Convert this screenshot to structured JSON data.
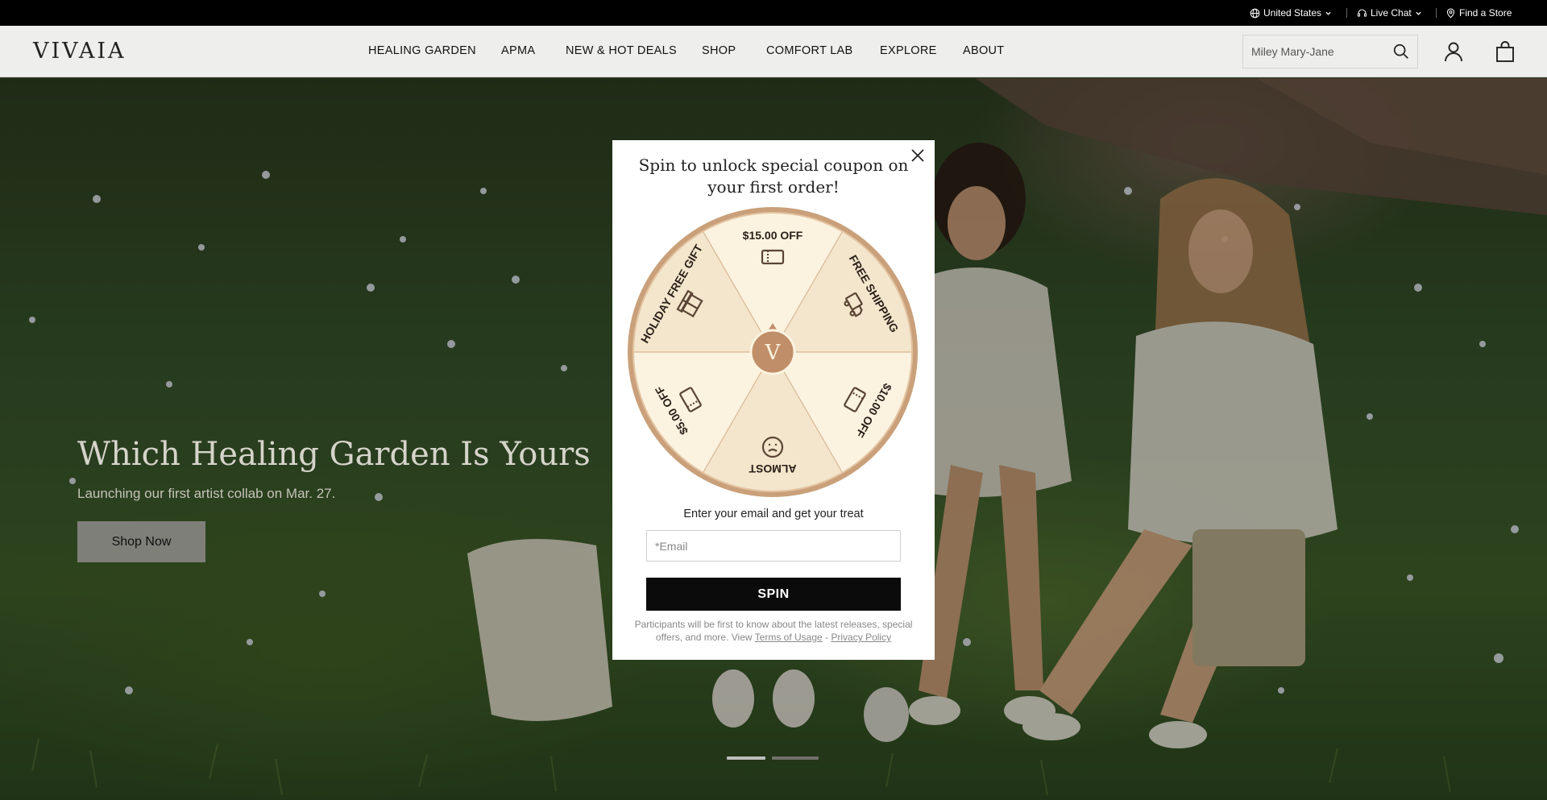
{
  "topbar": {
    "region": "United States",
    "live_chat": "Live Chat",
    "store": "Find a Store"
  },
  "header": {
    "logo": "VIVAIA",
    "nav": [
      "HEALING GARDEN",
      "APMA",
      "NEW & HOT DEALS",
      "SHOP",
      "COMFORT LAB",
      "EXPLORE",
      "ABOUT"
    ],
    "search_value": "Miley Mary-Jane"
  },
  "hero": {
    "title": "Which Healing Garden Is Yours",
    "subtitle": "Launching our first artist collab on Mar. 27.",
    "cta": "Shop Now",
    "slides_total": 2,
    "active_slide": 1
  },
  "popup": {
    "title": "Spin to unlock special coupon on your first order!",
    "wheel_segments": [
      "$15.00 OFF",
      "FREE SHIPPING",
      "$10.00 OFF",
      "ALMOST",
      "$5.00 OFF",
      "HOLIDAY FREE GIFT"
    ],
    "wheel_center": "V",
    "treat_text": "Enter your email and get your treat",
    "email_placeholder": "*Email",
    "spin_label": "SPIN",
    "fine_print": "Participants will be first to know about the latest releases, special offers, and more. View",
    "terms": "Terms of Usage",
    "separator": "-",
    "privacy": "Privacy Policy"
  },
  "colors": {
    "topbar": "#000000",
    "header_bg": "#eeeeec",
    "wheel_rim": "#c9a07a",
    "wheel_fill_a": "#fbf3e0",
    "wheel_fill_b": "#f3e6cc",
    "wheel_hub": "#c08e68",
    "spin_button": "#0b0b0b",
    "hero_button": "#8a8a85"
  }
}
